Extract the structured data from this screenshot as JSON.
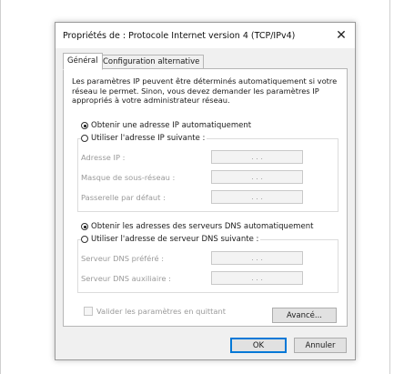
{
  "window": {
    "title": "Propriétés de : Protocole Internet version 4 (TCP/IPv4)",
    "close_glyph": "✕"
  },
  "tabs": [
    {
      "label": "Général",
      "selected": true
    },
    {
      "label": "Configuration alternative",
      "selected": false
    }
  ],
  "intro": "Les paramètres IP peuvent être déterminés automatiquement si votre réseau le permet. Sinon, vous devez demander les paramètres IP appropriés à votre administrateur réseau.",
  "ip": {
    "auto_label": "Obtenir une adresse IP automatiquement",
    "auto_selected": true,
    "manual_label": "Utiliser l'adresse IP suivante :",
    "manual_selected": false,
    "fields": [
      {
        "label": "Adresse IP :",
        "value": ".   .   ."
      },
      {
        "label": "Masque de sous-réseau :",
        "value": ".   .   ."
      },
      {
        "label": "Passerelle par défaut :",
        "value": ".   .   ."
      }
    ]
  },
  "dns": {
    "auto_label": "Obtenir les adresses des serveurs DNS automatiquement",
    "auto_selected": true,
    "manual_label": "Utiliser l'adresse de serveur DNS suivante :",
    "manual_selected": false,
    "fields": [
      {
        "label": "Serveur DNS préféré :",
        "value": ".   .   ."
      },
      {
        "label": "Serveur DNS auxiliaire :",
        "value": ".   .   ."
      }
    ]
  },
  "validate": {
    "label": "Valider les paramètres en quittant",
    "checked": false,
    "enabled": false
  },
  "buttons": {
    "advanced": "Avancé...",
    "ok": "OK",
    "cancel": "Annuler"
  }
}
